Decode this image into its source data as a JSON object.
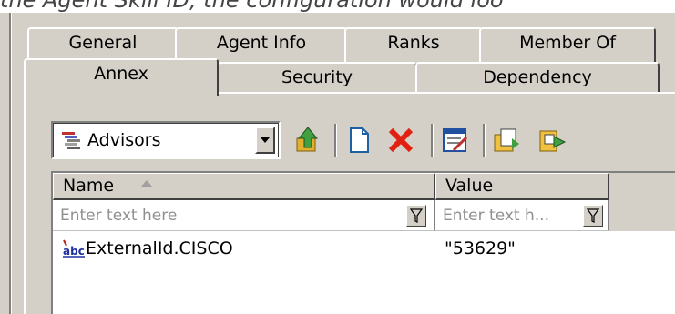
{
  "caption": {
    "text": "the Agent Skill ID, the configuration would loo"
  },
  "tabs": {
    "row_back": [
      {
        "label": "General"
      },
      {
        "label": "Agent Info"
      },
      {
        "label": "Ranks"
      },
      {
        "label": "Member Of"
      }
    ],
    "row_front": [
      {
        "label": "Annex",
        "active": true
      },
      {
        "label": "Security"
      },
      {
        "label": "Dependency"
      }
    ]
  },
  "toolbar": {
    "dropdown": {
      "selected": "Advisors",
      "icon": "stack-list-icon"
    },
    "buttons": [
      {
        "name": "move-up-button",
        "icon": "up-arrow-folder-icon"
      },
      {
        "name": "new-button",
        "icon": "new-document-icon"
      },
      {
        "name": "delete-button",
        "icon": "red-x-icon"
      },
      {
        "name": "edit-button",
        "icon": "edit-form-icon"
      },
      {
        "name": "copy-button",
        "icon": "copy-icon"
      },
      {
        "name": "export-button",
        "icon": "export-icon"
      }
    ]
  },
  "grid": {
    "columns": [
      {
        "label": "Name",
        "filter_placeholder": "Enter text here"
      },
      {
        "label": "Value",
        "filter_placeholder": "Enter text h..."
      }
    ],
    "rows": [
      {
        "icon": "abc-string-icon",
        "name": "ExternalId.CISCO",
        "value": "\"53629\""
      }
    ]
  },
  "colors": {
    "face": "#d4d0c8",
    "shadow": "#808080",
    "highlight": "#ffffff"
  }
}
